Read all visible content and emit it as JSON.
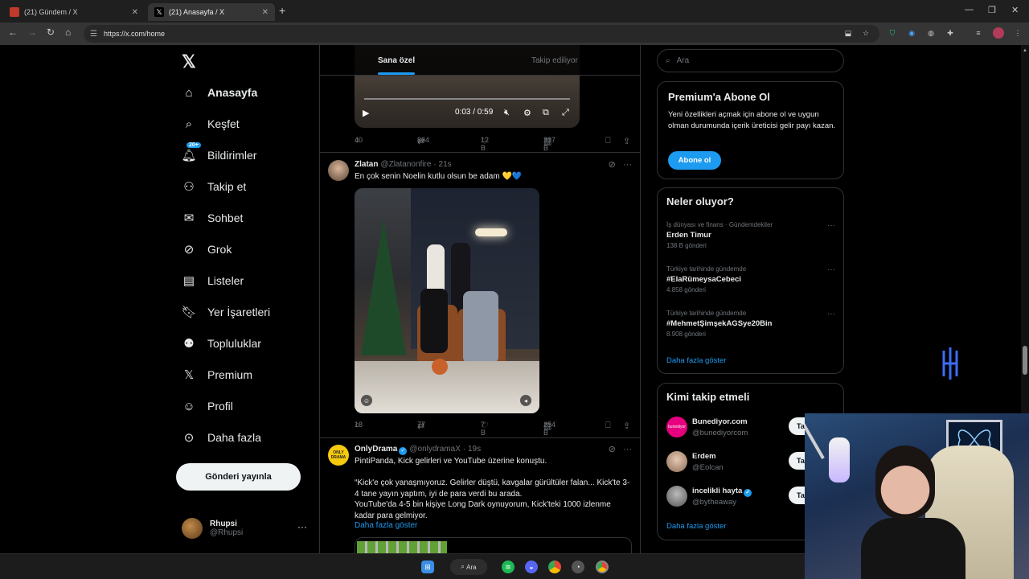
{
  "browser": {
    "tabs": [
      {
        "label": "(21) Gündem / X"
      },
      {
        "label": "(21) Anasayfa / X"
      }
    ],
    "new_tab": "+",
    "url": "https://x.com/home"
  },
  "nav": {
    "items": [
      {
        "label": "Anasayfa",
        "icon": "home-icon"
      },
      {
        "label": "Keşfet",
        "icon": "search-icon"
      },
      {
        "label": "Bildirimler",
        "icon": "bell-icon",
        "badge": "20+"
      },
      {
        "label": "Takip et",
        "icon": "add-user-icon"
      },
      {
        "label": "Sohbet",
        "icon": "mail-icon"
      },
      {
        "label": "Grok",
        "icon": "grok-icon"
      },
      {
        "label": "Listeler",
        "icon": "list-icon"
      },
      {
        "label": "Yer İşaretleri",
        "icon": "bookmark-icon"
      },
      {
        "label": "Topluluklar",
        "icon": "communities-icon"
      },
      {
        "label": "Premium",
        "icon": "x-icon"
      },
      {
        "label": "Profil",
        "icon": "profile-icon"
      },
      {
        "label": "Daha fazla",
        "icon": "more-circle-icon"
      }
    ],
    "post_button": "Gönderi yayınla",
    "profile": {
      "name": "Rhupsi",
      "handle": "@Rhupsi"
    }
  },
  "timeline": {
    "tabs": [
      "Sana özel",
      "Takip ediliyor"
    ],
    "video": {
      "time": "0:03 / 0:59"
    },
    "tweet0_actions": {
      "replies": "40",
      "reposts": "804",
      "likes": "12 B",
      "views": "337 B"
    },
    "tweet1": {
      "name": "Zlatan",
      "handle": "@Zlatanonfire",
      "time": "· 21s",
      "text": "En çok senin Noelin kutlu olsun be adam 💛💙",
      "actions": {
        "replies": "18",
        "reposts": "77",
        "likes": "7 B",
        "views": "254 B"
      }
    },
    "tweet2": {
      "name": "OnlyDrama",
      "handle": "@onlydramaX",
      "time": "· 19s",
      "line1": "PintiPanda, Kick gelirleri ve YouTube üzerine konuştu.",
      "line2": "“Kick'e çok yanaşmıyoruz. Gelirler düştü, kavgalar gürültüler falan... Kick'te 3-4 tane yayın yaptım, iyi de para verdi bu arada.",
      "line3": "YouTube'da 4-5 bin kişiye Long Dark oynuyorum, Kick'teki 1000 izlenme kadar para gelmiyor.",
      "more": "Daha fazla göster",
      "avatar_text": "ONLY DRAMA"
    }
  },
  "right": {
    "search_placeholder": "Ara",
    "premium": {
      "title": "Premium'a Abone Ol",
      "text": "Yeni özellikleri açmak için abone ol ve uygun olman durumunda içerik üreticisi gelir payı kazan.",
      "button": "Abone ol"
    },
    "trends": {
      "title": "Neler oluyor?",
      "items": [
        {
          "context": "İş dünyası ve finans · Gündemdekiler",
          "title": "Erden Timur",
          "count": "138 B gönderi"
        },
        {
          "context": "Türkiye tarihinde gündemde",
          "title": "#ElaRümeysaCebeci",
          "count": "4.858 gönderi"
        },
        {
          "context": "Türkiye tarihinde gündemde",
          "title": "#MehmetŞimşekAGSye20Bin",
          "count": "8.908 gönderi"
        }
      ],
      "show_more": "Daha fazla göster"
    },
    "who_to_follow": {
      "title": "Kimi takip etmeli",
      "items": [
        {
          "name": "Bunediyor.com",
          "handle": "@bunediyorcom",
          "button": "Takip et",
          "avatar_text": "bunediyor"
        },
        {
          "name": "Erdem",
          "handle": "@Eolcan",
          "button": "Takip et"
        },
        {
          "name": "incelikli hayta",
          "handle": "@bytheaway",
          "button": "Takip et"
        }
      ],
      "show_more": "Daha fazla göster"
    }
  },
  "taskbar": {
    "search": "Ara"
  },
  "colors": {
    "accent": "#1d9bf0",
    "background": "#000000",
    "border": "#2f3336",
    "muted": "#71767b"
  }
}
